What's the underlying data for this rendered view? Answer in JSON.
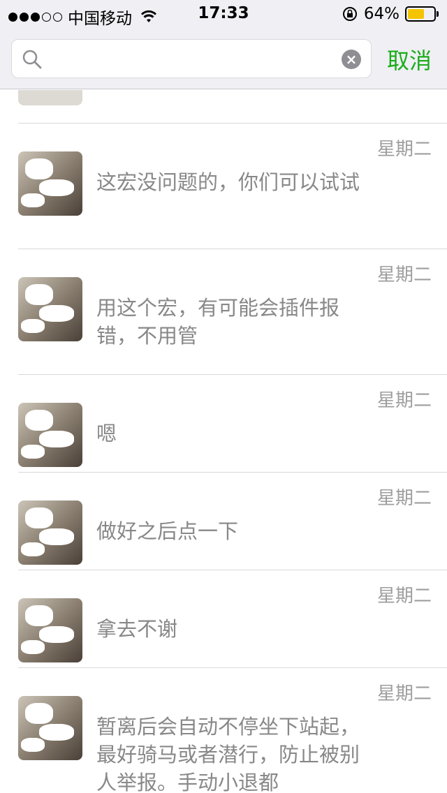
{
  "status_bar": {
    "carrier": "中国移动",
    "time": "17:33",
    "battery_percent": "64%",
    "battery_level": 0.64,
    "signal_dots_filled": 3,
    "signal_dots_total": 5
  },
  "search": {
    "query": "",
    "placeholder": "",
    "cancel_label": "取消"
  },
  "colors": {
    "accent_green": "#1aad19",
    "battery_yellow": "#f5c400",
    "meta_gray": "#9e9e9e"
  },
  "results": [
    {
      "date": "星期二",
      "message": "这宏没问题的，你们可以试试"
    },
    {
      "date": "星期二",
      "message": "用这个宏，有可能会插件报错，不用管"
    },
    {
      "date": "星期二",
      "message": "嗯"
    },
    {
      "date": "星期二",
      "message": "做好之后点一下"
    },
    {
      "date": "星期二",
      "message": "拿去不谢"
    },
    {
      "date": "星期二",
      "message": "暂离后会自动不停坐下站起，最好骑马或者潜行，防止被别人举报。手动小退都"
    }
  ]
}
